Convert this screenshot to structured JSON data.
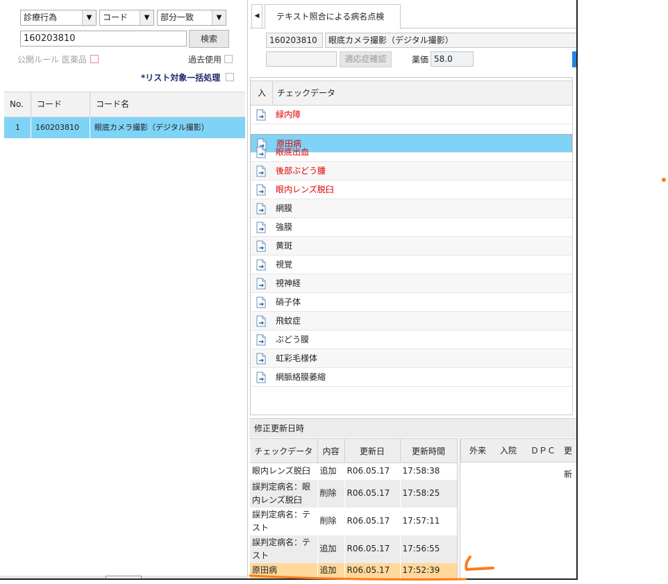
{
  "search": {
    "category_select": "診療行為",
    "field_select": "コード",
    "match_select": "部分一致",
    "query_value": "160203810",
    "search_button": "検索",
    "public_rule_label": "公開ルール 医薬品",
    "past_use_label": "過去使用",
    "bulk_label": "*リスト対象一括処理"
  },
  "left_table": {
    "headers": {
      "no": "No.",
      "code": "コード",
      "name": "コード名"
    },
    "rows": [
      {
        "no": "1",
        "code": "160203810",
        "name": "眼底カメラ撮影（デジタル撮影）"
      }
    ]
  },
  "right": {
    "tab_title": "テキスト照合による病名点検",
    "code_value": "160203810",
    "name_value": "眼底カメラ撮影（デジタル撮影）",
    "indication_input": "",
    "confirm_button": "適応症確認",
    "price_label": "薬価",
    "price_value": "58.0",
    "check_headers": {
      "in": "入",
      "data": "チェックデータ"
    },
    "check_items": [
      {
        "label": "緑内障",
        "red": true
      },
      {
        "label": "原田病",
        "red": true,
        "selected": true
      },
      {
        "label": "眼底出血",
        "red": true
      },
      {
        "label": "後部ぶどう腫",
        "red": true
      },
      {
        "label": "眼内レンズ脱臼",
        "red": true
      },
      {
        "label": "網膜",
        "red": false
      },
      {
        "label": "強膜",
        "red": false
      },
      {
        "label": "黄斑",
        "red": false
      },
      {
        "label": "視覚",
        "red": false
      },
      {
        "label": "視神経",
        "red": false
      },
      {
        "label": "硝子体",
        "red": false
      },
      {
        "label": "飛蚊症",
        "red": false
      },
      {
        "label": "ぶどう膜",
        "red": false
      },
      {
        "label": "虹彩毛様体",
        "red": false
      },
      {
        "label": "網脈絡膜萎縮",
        "red": false
      }
    ]
  },
  "history": {
    "title": "修正更新日時",
    "headers": {
      "data": "チェックデータ",
      "content": "内容",
      "date": "更新日",
      "time": "更新時間"
    },
    "right_headers": {
      "outpatient": "外来",
      "inpatient": "入院",
      "dpc": "ＤＰＣ",
      "update": "更新"
    },
    "rows": [
      {
        "data": "眼内レンズ脱臼",
        "content": "追加",
        "date": "R06.05.17",
        "time": "17:58:38"
      },
      {
        "data": "誤判定病名：眼内レンズ脱臼",
        "content": "削除",
        "date": "R06.05.17",
        "time": "17:58:25"
      },
      {
        "data": "誤判定病名：テスト",
        "content": "削除",
        "date": "R06.05.17",
        "time": "17:57:11"
      },
      {
        "data": "誤判定病名：テスト",
        "content": "追加",
        "date": "R06.05.17",
        "time": "17:56:55"
      },
      {
        "data": "原田病",
        "content": "追加",
        "date": "R06.05.17",
        "time": "17:52:39"
      }
    ]
  },
  "colors": {
    "selection_blue": "#7fd3f7",
    "highlight_orange": "#ffd89a",
    "annotation_orange": "#ff7a1a",
    "error_red": "#e00000"
  }
}
